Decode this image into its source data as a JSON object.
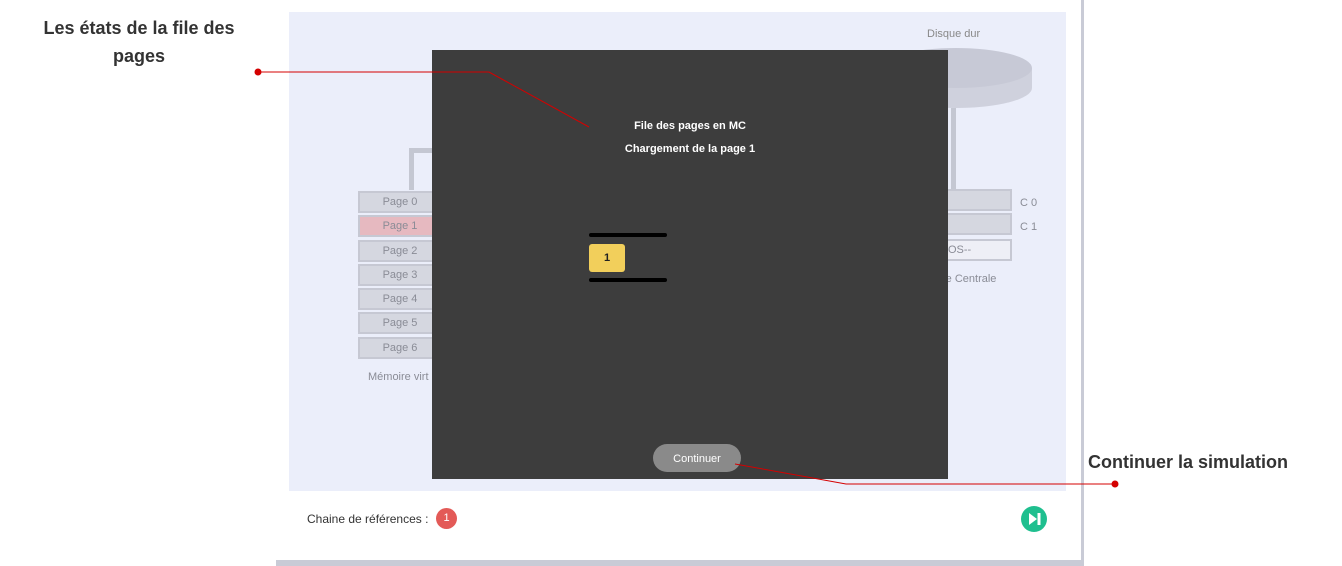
{
  "annotations": {
    "left_callout": "Les états de la file des pages",
    "right_callout": "Continuer la simulation"
  },
  "disk": {
    "label": "Disque dur"
  },
  "virtual_memory": {
    "rows": [
      "Page 0",
      "Page 1",
      "Page 2",
      "Page 3",
      "Page 4",
      "Page 5",
      "Page 6"
    ],
    "highlighted_index": 1,
    "caption": "Mémoire virt"
  },
  "central_memory": {
    "frame_labels": [
      "C 0",
      "C 1"
    ],
    "os_cell": "OS--",
    "caption": "re Centrale"
  },
  "modal": {
    "title": "File des pages en MC",
    "subtitle": "Chargement de la page 1",
    "queue": [
      "1"
    ],
    "continue_label": "Continuer"
  },
  "footer": {
    "references_label": "Chaine de références :",
    "references": [
      "1"
    ],
    "next_icon": "skip-next-icon"
  },
  "colors": {
    "modal_bg": "#3d3d3d",
    "queue_item": "#f2cf5b",
    "reference_badge": "#e35a57",
    "next_button": "#1fbf8f",
    "annotation_line": "#d40000"
  }
}
